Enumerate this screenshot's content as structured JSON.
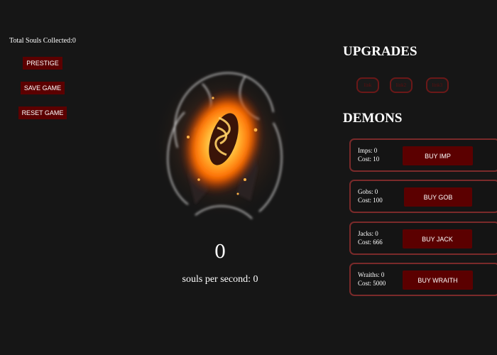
{
  "left": {
    "total_souls_label": "Total Souls Collected:",
    "total_souls_value": "0",
    "prestige_label": "PRESTIGE",
    "save_label": "SAVE GAME",
    "reset_label": "RESET GAME"
  },
  "center": {
    "soul_count": "0",
    "sps_label": "souls per second: ",
    "sps_value": "0"
  },
  "upgrades": {
    "title": "UPGRADES",
    "buttons": [
      "link",
      "link2",
      "link3"
    ]
  },
  "demons": {
    "title": "DEMONS",
    "items": [
      {
        "owned_label": "Imps: ",
        "owned": "0",
        "cost_label": "Cost: ",
        "cost": "10",
        "buy_label": "BUY IMP"
      },
      {
        "owned_label": "Gobs: ",
        "owned": "0",
        "cost_label": "Cost: ",
        "cost": "100",
        "buy_label": "BUY GOB"
      },
      {
        "owned_label": "Jacks: ",
        "owned": "0",
        "cost_label": "Cost: ",
        "cost": "666",
        "buy_label": "BUY JACK"
      },
      {
        "owned_label": "Wraiths: ",
        "owned": "0",
        "cost_label": "Cost: ",
        "cost": "5000",
        "buy_label": "BUY WRAITH"
      }
    ]
  },
  "colors": {
    "background": "#161616",
    "button_red": "#5b0000",
    "card_border": "#7a2a2a"
  }
}
